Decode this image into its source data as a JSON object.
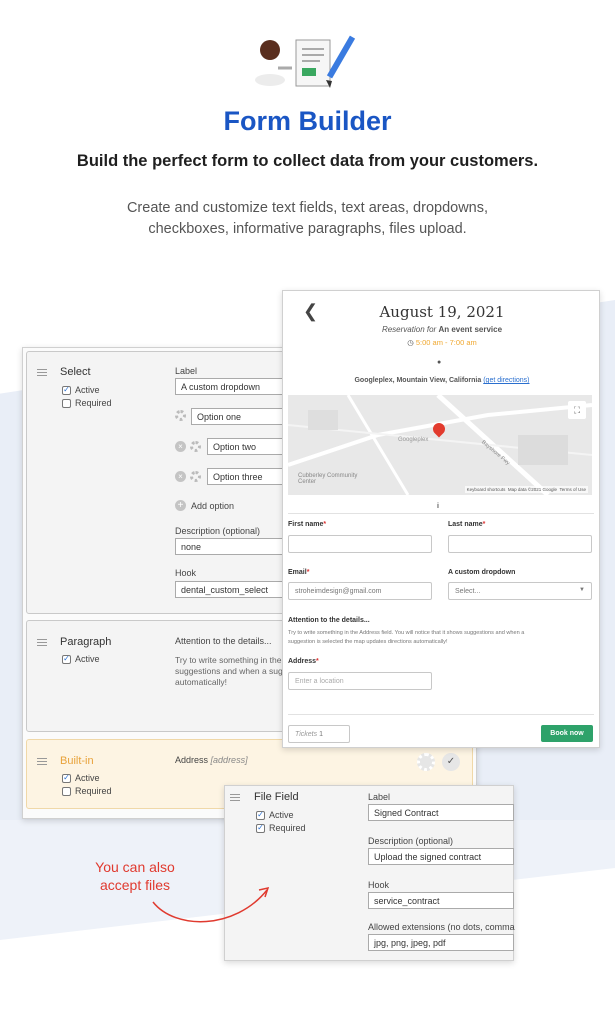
{
  "header": {
    "title": "Form Builder",
    "subtitle": "Build the perfect form to collect data from your customers.",
    "description_line1": "Create and customize text fields, text areas, dropdowns,",
    "description_line2": "checkboxes, informative paragraphs, files upload."
  },
  "colors": {
    "accent": "#1a56c4",
    "book": "#2ea26a",
    "builtin_bg": "#fdf4e3",
    "annotation": "#e03a2f"
  },
  "builder": {
    "select_card": {
      "title": "Select",
      "active_label": "Active",
      "required_label": "Required",
      "label_caption": "Label",
      "label_value": "A custom dropdown",
      "options": [
        "Option one",
        "Option two",
        "Option three"
      ],
      "add_option": "Add option",
      "description_caption": "Description (optional)",
      "description_value": "none",
      "hook_caption": "Hook",
      "hook_value": "dental_custom_select"
    },
    "paragraph_card": {
      "title": "Paragraph",
      "active_label": "Active",
      "heading": "Attention to the details...",
      "body": "Try to write something in the Address field. You will notice that it shows suggestions and when a suggestion is selected the map updates directions automatically!"
    },
    "builtin_card": {
      "title": "Built-in",
      "active_label": "Active",
      "required_label": "Required",
      "field_label": "Address",
      "field_hook": "[address]"
    }
  },
  "preview": {
    "date": "August 19, 2021",
    "reservation_prefix": "Reservation for",
    "service": "An event service",
    "time": "5:00 am - 7:00 am",
    "location": "Googleplex, Mountain View, California",
    "directions_link": "(get directions)",
    "map": {
      "place": "Googleplex",
      "community": "Cubberley Community Center",
      "road": "Bayshore Fwy",
      "shortcuts": "Keyboard shortcuts",
      "map_data": "Map data ©2021 Google",
      "terms": "Terms of Use"
    },
    "first_name_label": "First name",
    "last_name_label": "Last name",
    "email_label": "Email",
    "email_value": "stroheimdesign@gmail.com",
    "dropdown_label": "A custom dropdown",
    "dropdown_placeholder": "Select...",
    "attention_heading": "Attention to the details...",
    "attention_body_line1": "Try to write something in the Address field. You will notice that it shows suggestions and when a",
    "attention_body_line2": "suggestion is selected the map updates directions automatically!",
    "address_label": "Address",
    "address_placeholder": "Enter a location",
    "tickets_label": "Tickets",
    "tickets_value": "1",
    "book_button": "Book now"
  },
  "file_field": {
    "title": "File Field",
    "active_label": "Active",
    "required_label": "Required",
    "label_caption": "Label",
    "label_value": "Signed Contract",
    "description_caption": "Description (optional)",
    "description_value": "Upload the signed contract",
    "hook_caption": "Hook",
    "hook_value": "service_contract",
    "extensions_caption": "Allowed extensions (no dots, comma",
    "extensions_value": "jpg, png, jpeg, pdf"
  },
  "annotation": {
    "line1": "You can also",
    "line2": "accept files"
  }
}
